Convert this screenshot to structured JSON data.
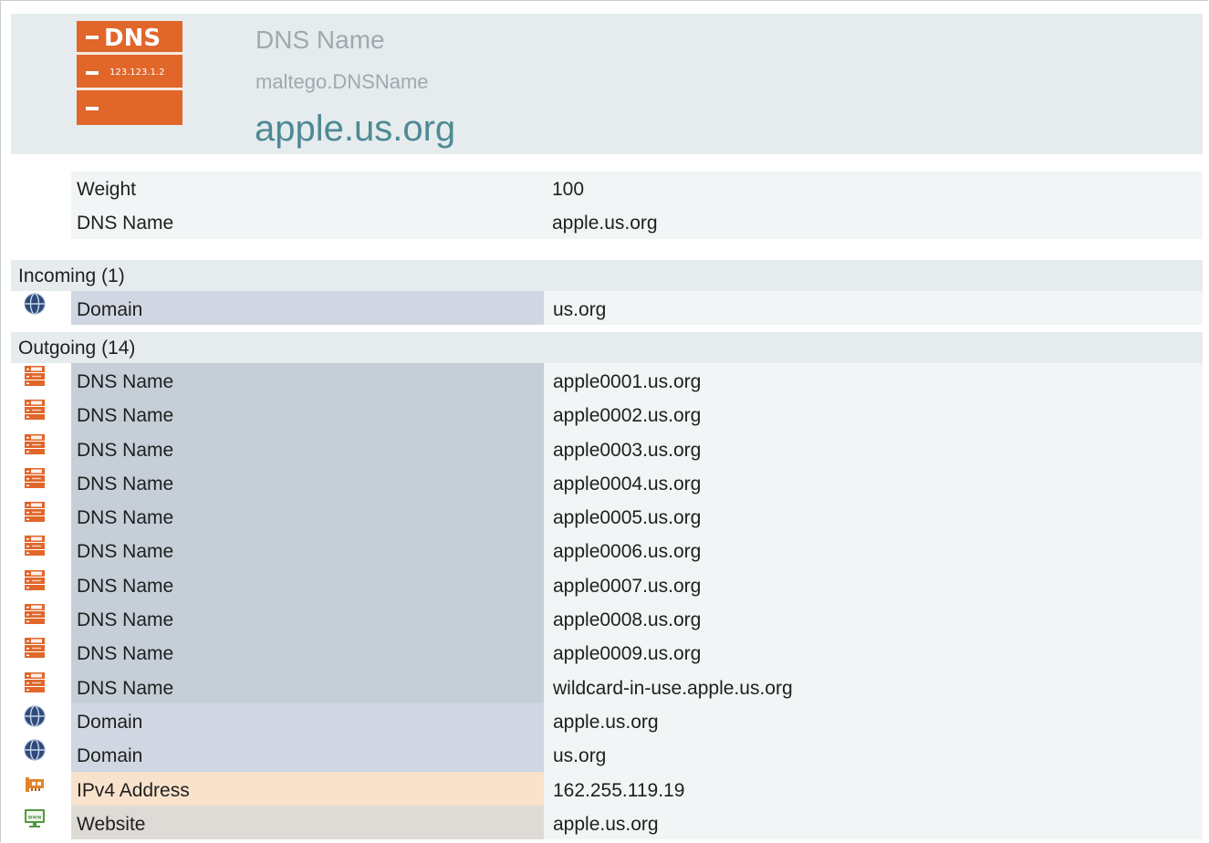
{
  "entity": {
    "type_name": "DNS Name",
    "type_id": "maltego.DNSName",
    "value": "apple.us.org",
    "icon": "dns-name-icon",
    "icon_text_top": "DNS",
    "icon_text_ip": "123.123.1.2"
  },
  "properties": [
    {
      "name": "Weight",
      "value": "100"
    },
    {
      "name": "DNS Name",
      "value": "apple.us.org"
    }
  ],
  "incoming": {
    "title": "Incoming (1)",
    "items": [
      {
        "type": "Domain",
        "value": "us.org",
        "icon": "domain-globe-icon"
      }
    ]
  },
  "outgoing": {
    "title": "Outgoing (14)",
    "items": [
      {
        "type": "DNS Name",
        "value": "apple0001.us.org",
        "icon": "dns-name-icon"
      },
      {
        "type": "DNS Name",
        "value": "apple0002.us.org",
        "icon": "dns-name-icon"
      },
      {
        "type": "DNS Name",
        "value": "apple0003.us.org",
        "icon": "dns-name-icon"
      },
      {
        "type": "DNS Name",
        "value": "apple0004.us.org",
        "icon": "dns-name-icon"
      },
      {
        "type": "DNS Name",
        "value": "apple0005.us.org",
        "icon": "dns-name-icon"
      },
      {
        "type": "DNS Name",
        "value": "apple0006.us.org",
        "icon": "dns-name-icon"
      },
      {
        "type": "DNS Name",
        "value": "apple0007.us.org",
        "icon": "dns-name-icon"
      },
      {
        "type": "DNS Name",
        "value": "apple0008.us.org",
        "icon": "dns-name-icon"
      },
      {
        "type": "DNS Name",
        "value": "apple0009.us.org",
        "icon": "dns-name-icon"
      },
      {
        "type": "DNS Name",
        "value": "wildcard-in-use.apple.us.org",
        "icon": "dns-name-icon"
      },
      {
        "type": "Domain",
        "value": "apple.us.org",
        "icon": "domain-globe-icon"
      },
      {
        "type": "Domain",
        "value": "us.org",
        "icon": "domain-globe-icon"
      },
      {
        "type": "IPv4 Address",
        "value": "162.255.119.19",
        "icon": "ipv4-network-card-icon"
      },
      {
        "type": "Website",
        "value": "apple.us.org",
        "icon": "website-monitor-icon"
      }
    ]
  },
  "colors": {
    "dns_orange": "#e0662a",
    "header_bg": "#e6ecee",
    "value_teal": "#4e8a94",
    "muted_text": "#a2a8ae"
  }
}
